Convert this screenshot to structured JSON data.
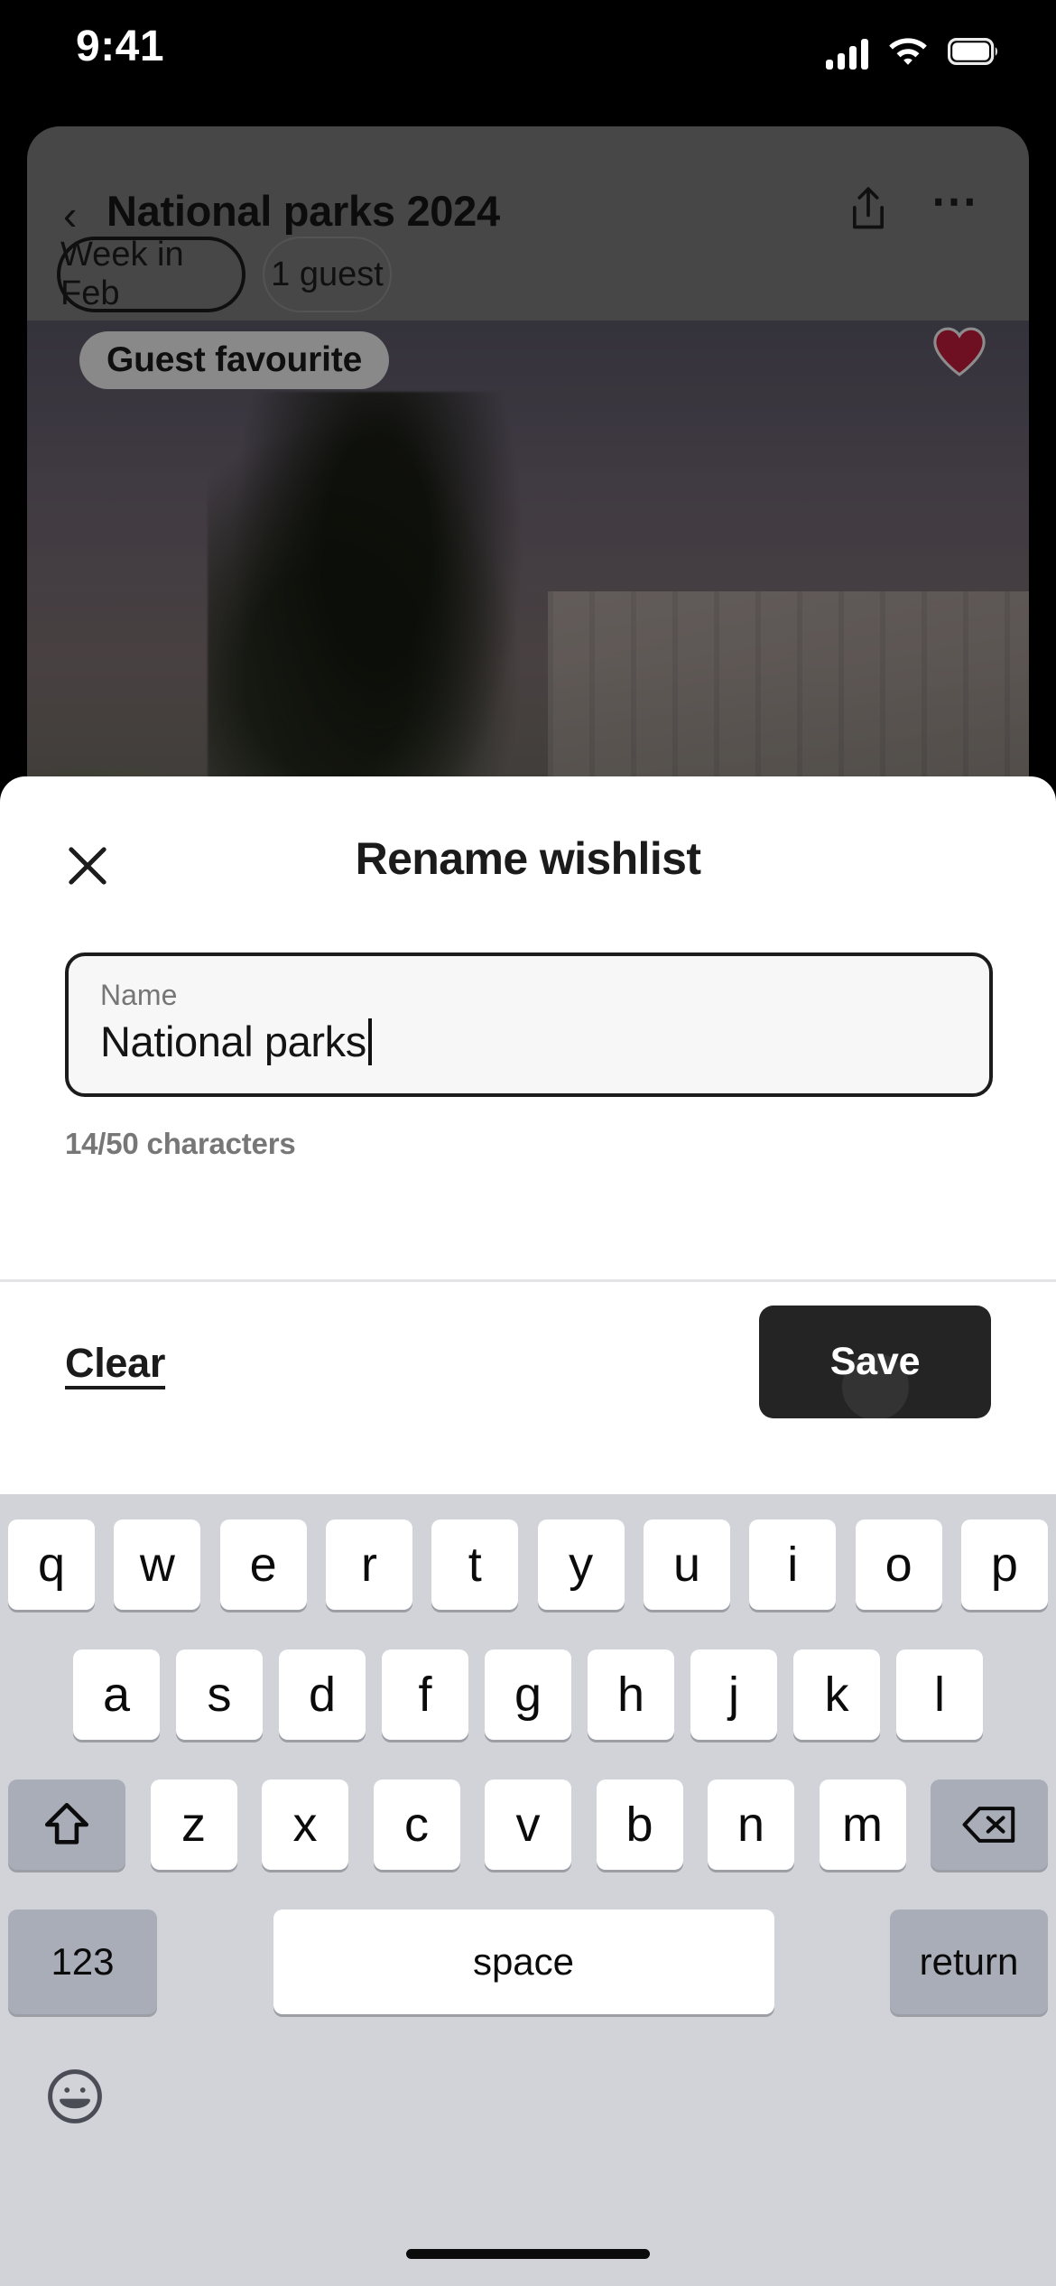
{
  "status_bar": {
    "time": "9:41",
    "cellular_icon": "signal-bars-icon",
    "wifi_icon": "wifi-icon",
    "battery_icon": "battery-icon"
  },
  "background_app": {
    "back_icon": "chevron-left-icon",
    "title": "National parks 2024",
    "share_icon": "share-icon",
    "more_icon": "more-options-icon",
    "filters": [
      {
        "label": "Week in Feb",
        "selected": true
      },
      {
        "label": "1 guest",
        "selected": false
      }
    ],
    "listing": {
      "badge": "Guest favourite",
      "favourite_icon": "heart-filled-icon",
      "favourite_color": "#c01a3c"
    }
  },
  "modal": {
    "close_icon": "close-icon",
    "title": "Rename wishlist",
    "field": {
      "label": "Name",
      "value": "National parks",
      "caret_visible": true
    },
    "char_counter": "14/50 characters",
    "footer": {
      "clear_label": "Clear",
      "save_label": "Save",
      "save_bg": "#242424"
    }
  },
  "keyboard": {
    "row1": [
      "q",
      "w",
      "e",
      "r",
      "t",
      "y",
      "u",
      "i",
      "o",
      "p"
    ],
    "row2": [
      "a",
      "s",
      "d",
      "f",
      "g",
      "h",
      "j",
      "k",
      "l"
    ],
    "row3_shift_icon": "shift-icon",
    "row3": [
      "z",
      "x",
      "c",
      "v",
      "b",
      "n",
      "m"
    ],
    "row3_backspace_icon": "backspace-icon",
    "numbers_label": "123",
    "space_label": "space",
    "return_label": "return",
    "emoji_icon": "emoji-icon",
    "home_indicator": "home-indicator"
  }
}
